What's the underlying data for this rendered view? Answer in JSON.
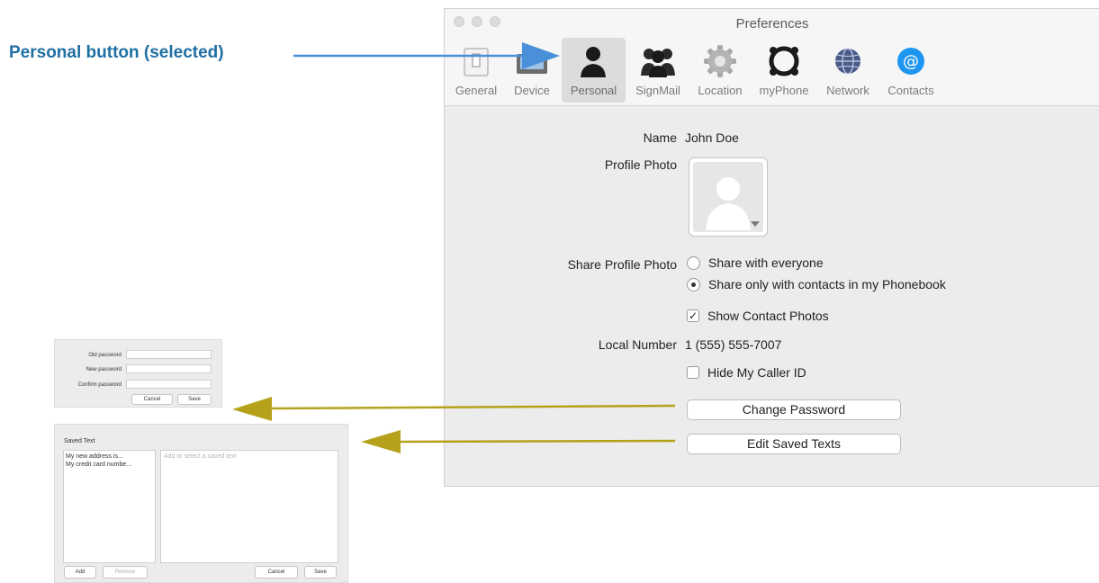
{
  "callout": {
    "label": "Personal button (selected)",
    "arrow_color": "#4a90d9",
    "gold_arrow_color": "#b5a21a"
  },
  "window": {
    "title": "Preferences",
    "tabs": [
      {
        "label": "General",
        "icon": "general-icon"
      },
      {
        "label": "Device",
        "icon": "device-icon"
      },
      {
        "label": "Personal",
        "icon": "person-icon",
        "selected": true
      },
      {
        "label": "SignMail",
        "icon": "group-icon"
      },
      {
        "label": "Location",
        "icon": "gear-icon"
      },
      {
        "label": "myPhone",
        "icon": "myphone-icon"
      },
      {
        "label": "Network",
        "icon": "globe-icon"
      },
      {
        "label": "Contacts",
        "icon": "at-icon"
      }
    ]
  },
  "personal": {
    "name_label": "Name",
    "name_value": "John Doe",
    "photo_label": "Profile Photo",
    "share_label": "Share Profile Photo",
    "share_everyone": "Share with everyone",
    "share_contacts": "Share only with contacts in my Phonebook",
    "share_selected": "contacts",
    "show_photos": "Show Contact Photos",
    "show_photos_checked": true,
    "local_number_label": "Local Number",
    "local_number_value": "1 (555) 555-7007",
    "hide_caller_id": "Hide My Caller ID",
    "hide_caller_id_checked": false,
    "change_password": "Change Password",
    "edit_saved_texts": "Edit Saved Texts"
  },
  "password_dialog": {
    "old": "Old password",
    "new": "New password",
    "confirm": "Confirm password",
    "cancel": "Cancel",
    "save": "Save"
  },
  "saved_text_dialog": {
    "title": "Saved Text",
    "items": [
      "My new address is...",
      "My credit card numbe..."
    ],
    "placeholder": "Add or select a saved text",
    "add": "Add",
    "remove": "Remove",
    "cancel": "Cancel",
    "save": "Save"
  }
}
